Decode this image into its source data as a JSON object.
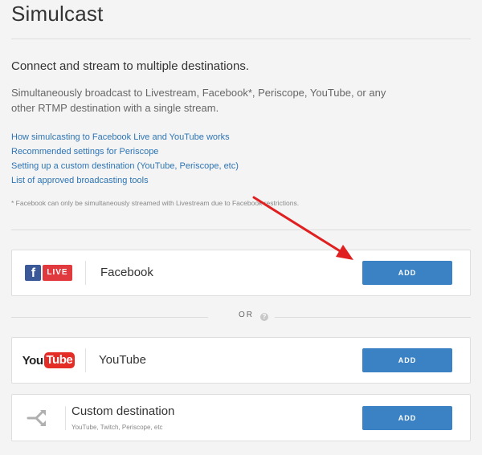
{
  "page": {
    "title": "Simulcast",
    "subtitle": "Connect and stream to multiple destinations.",
    "description": "Simultaneously broadcast to Livestream, Facebook*, Periscope, YouTube, or any other RTMP destination with a single stream.",
    "help_links": [
      "How simulcasting to Facebook Live and YouTube works",
      "Recommended settings for Periscope",
      "Setting up a custom destination (YouTube, Periscope, etc)",
      "List of approved broadcasting tools"
    ],
    "footnote": "* Facebook can only be simultaneously streamed with Livestream due to Facebook restrictions."
  },
  "destinations": {
    "facebook": {
      "name": "Facebook",
      "logo_letter": "f",
      "logo_badge": "LIVE",
      "button_label": "ADD"
    },
    "youtube": {
      "name": "YouTube",
      "logo_you": "You",
      "logo_tube": "Tube",
      "button_label": "ADD"
    },
    "custom": {
      "name": "Custom destination",
      "subtitle": "YouTube, Twitch, Periscope, etc",
      "button_label": "ADD"
    }
  },
  "divider": {
    "or_label": "OR",
    "help_icon": "?"
  },
  "colors": {
    "accent": "#3b82c4",
    "link": "#2d74b4",
    "facebook_blue": "#3b5998",
    "live_red": "#e0393e",
    "youtube_red": "#e52d27",
    "annotation_arrow": "#e02020"
  },
  "icons": {
    "help": "question-circle-icon",
    "custom_destination": "split-arrows-icon",
    "annotation": "red-arrow-icon"
  }
}
